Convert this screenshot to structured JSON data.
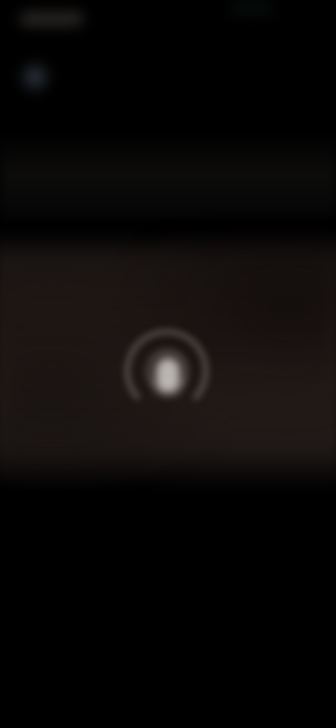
{
  "screen": {
    "background": "#000000",
    "card_color": "#251d1a"
  },
  "status_bar": {
    "time": "",
    "icons": [
      "signal-icon"
    ]
  },
  "header": {
    "back_icon": "back-icon"
  },
  "media": {
    "state": "loading",
    "spinner_icon": "loading-spinner-icon"
  }
}
